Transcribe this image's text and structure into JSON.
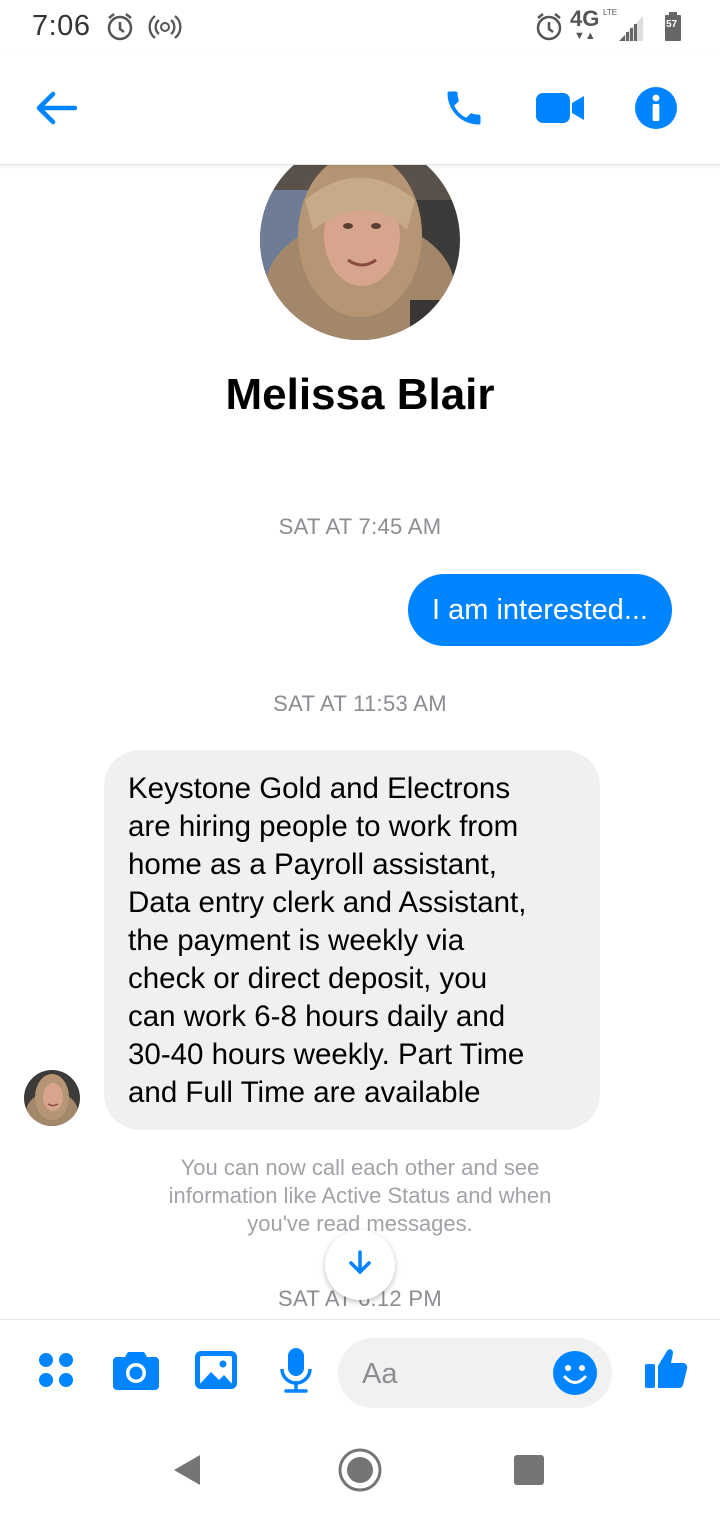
{
  "status_bar": {
    "time": "7:06",
    "network": "4G",
    "lte": "LTE",
    "battery": "57",
    "icons": [
      "alarm-icon",
      "hotspot-icon",
      "alarm-icon",
      "signal-icon",
      "battery-icon"
    ]
  },
  "header": {
    "icons": [
      "back-arrow-icon",
      "phone-icon",
      "video-camera-icon",
      "info-icon"
    ]
  },
  "profile": {
    "name": "Melissa Blair"
  },
  "messages": [
    {
      "timestamp": "SAT AT 7:45 AM"
    },
    {
      "direction": "outgoing",
      "text": "I am interested..."
    },
    {
      "timestamp": "SAT AT 11:53 AM"
    },
    {
      "direction": "incoming",
      "lines": [
        "Keystone Gold and Electrons",
        "are hiring people to work from",
        "home as a Payroll assistant,",
        "Data entry clerk and Assistant,",
        "the payment is weekly via",
        "check or direct deposit, you",
        "can work 6-8 hours daily and",
        "30-40 hours weekly. Part Time",
        "and Full Time are available"
      ]
    }
  ],
  "info_notice": {
    "lines": [
      "You can now call each other and see",
      "information like Active Status and when",
      "you've read messages."
    ]
  },
  "last_timestamp": "SAT AT 6:12 PM",
  "composer": {
    "placeholder": "Aa",
    "icons": [
      "menu-dots-icon",
      "camera-icon",
      "gallery-icon",
      "microphone-icon",
      "emoji-icon",
      "thumbs-up-icon"
    ]
  },
  "nav": {
    "icons": [
      "back-triangle-icon",
      "home-circle-icon",
      "recents-square-icon"
    ]
  },
  "colors": {
    "accent": "#0084ff",
    "bubble_in": "#f0f0f0",
    "muted": "#8a8d91"
  }
}
